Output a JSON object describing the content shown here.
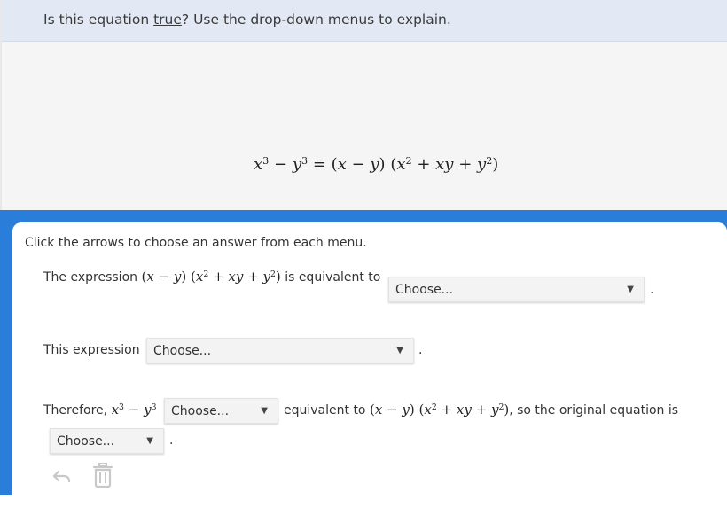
{
  "header": {
    "prompt_before": "Is this equation ",
    "prompt_underlined": "true",
    "prompt_after": "? Use the drop-down menus to explain."
  },
  "equation": "x³ − y³ = (x − y) (x² + xy + y²)",
  "instructions": "Click the arrows to choose an answer from each menu.",
  "row1": {
    "before": "The expression",
    "math": "(x − y) (x² + xy + y²)",
    "after": "is equivalent to",
    "dropdown": "Choose...",
    "end": "."
  },
  "row2": {
    "before": "This expression",
    "dropdown": "Choose...",
    "end": "."
  },
  "row3": {
    "before": "Therefore,",
    "math": "x³ − y³",
    "dropdown": "Choose...",
    "middle": "equivalent to",
    "math2": "(x − y) (x² + xy + y²)",
    "after": ", so the original equation is",
    "dropdown2": "Choose...",
    "end": "."
  },
  "toolbar": {
    "undo_icon": "undo-icon",
    "delete_icon": "trash-icon"
  },
  "colors": {
    "accent_blue": "#2a7dd9",
    "header_bg": "#e3e9f4",
    "panel_bg": "#f5f5f5"
  }
}
